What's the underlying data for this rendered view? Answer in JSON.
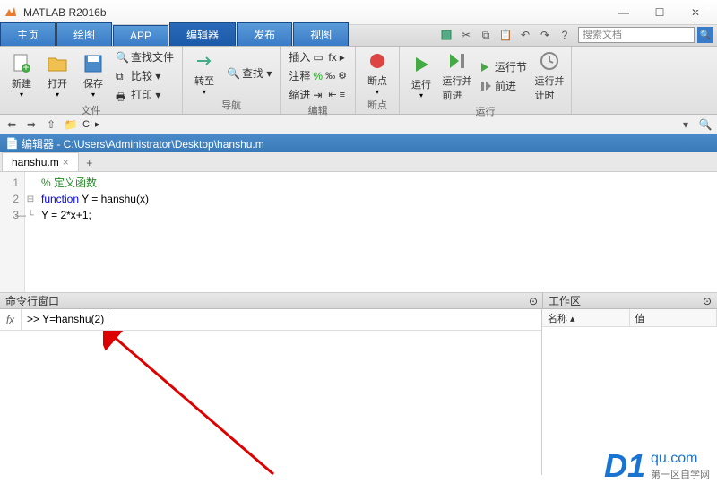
{
  "window": {
    "title": "MATLAB R2016b"
  },
  "tabs": {
    "home": "主页",
    "plots": "绘图",
    "apps": "APP",
    "editor": "编辑器",
    "publish": "发布",
    "view": "视图"
  },
  "search": {
    "placeholder": "搜索文档"
  },
  "ribbon": {
    "file": {
      "label": "文件",
      "new": "新建",
      "open": "打开",
      "save": "保存",
      "findfiles": "查找文件",
      "compare": "比较 ▾",
      "print": "打印 ▾"
    },
    "nav": {
      "label": "导航",
      "goto": "转至",
      "find": "查找 ▾"
    },
    "edit": {
      "label": "编辑",
      "comment": "注释",
      "indent": "缩进",
      "insert": "插入",
      "fx": "fx",
      "arrow": "▸"
    },
    "bp": {
      "label": "断点",
      "breakpoints": "断点"
    },
    "run": {
      "label": "运行",
      "run": "运行",
      "runadvance": "运行并\n前进",
      "runsection": "运行节",
      "advance": "前进",
      "runtime": "运行并\n计时"
    }
  },
  "addressbar": {
    "path": "C: ▸"
  },
  "editorbar": {
    "title": "编辑器 - C:\\Users\\Administrator\\Desktop\\hanshu.m"
  },
  "filetab": {
    "name": "hanshu.m"
  },
  "code": {
    "l1_comment": "% 定义函数",
    "l2_kw": "function",
    "l2_rest": " Y = hanshu(x)",
    "l3": "Y = 2*x+1;"
  },
  "gutter": {
    "l1": "1",
    "l2": "2",
    "l3": "3"
  },
  "cmd": {
    "title": "命令行窗口",
    "prompt": ">> ",
    "input": "Y=hanshu(2)"
  },
  "workspace": {
    "title": "工作区",
    "col_name": "名称 ▴",
    "col_value": "值"
  },
  "watermark": {
    "logo": "D1",
    "text": "qu.com",
    "sub": "第一区自学网"
  }
}
